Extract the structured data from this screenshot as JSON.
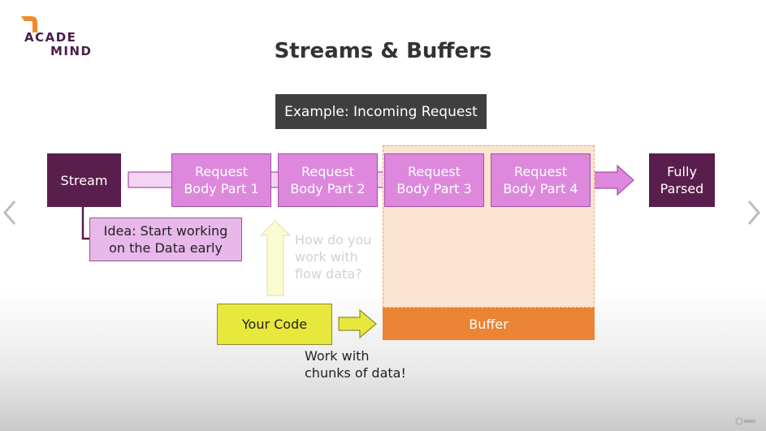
{
  "logo": {
    "line1": "ACADE",
    "line2": "MIND"
  },
  "slide": {
    "title": "Streams & Buffers",
    "example": "Example: Incoming Request",
    "stream": "Stream",
    "parts": [
      "Request\nBody Part 1",
      "Request\nBody Part 2",
      "Request\nBody Part 3",
      "Request\nBody Part 4"
    ],
    "fully_parsed": "Fully\nParsed",
    "idea": "Idea: Start working\non the Data early",
    "question": "How do you\nwork with\nflow data?",
    "your_code": "Your Code",
    "buffer": "Buffer",
    "work": "Work with\nchunks of data!"
  },
  "nav": {
    "prev_icon": "chevron-left-icon",
    "next_icon": "chevron-right-icon"
  },
  "colors": {
    "dark_purple": "#5a1e4e",
    "part_pink": "#dd88dd",
    "idea_pink": "#e8b8ea",
    "buffer_orange": "#eb8434",
    "buffer_area": "#fbe4d2",
    "code_yellow": "#e8e73c",
    "example_bg": "#3f3f3f"
  }
}
